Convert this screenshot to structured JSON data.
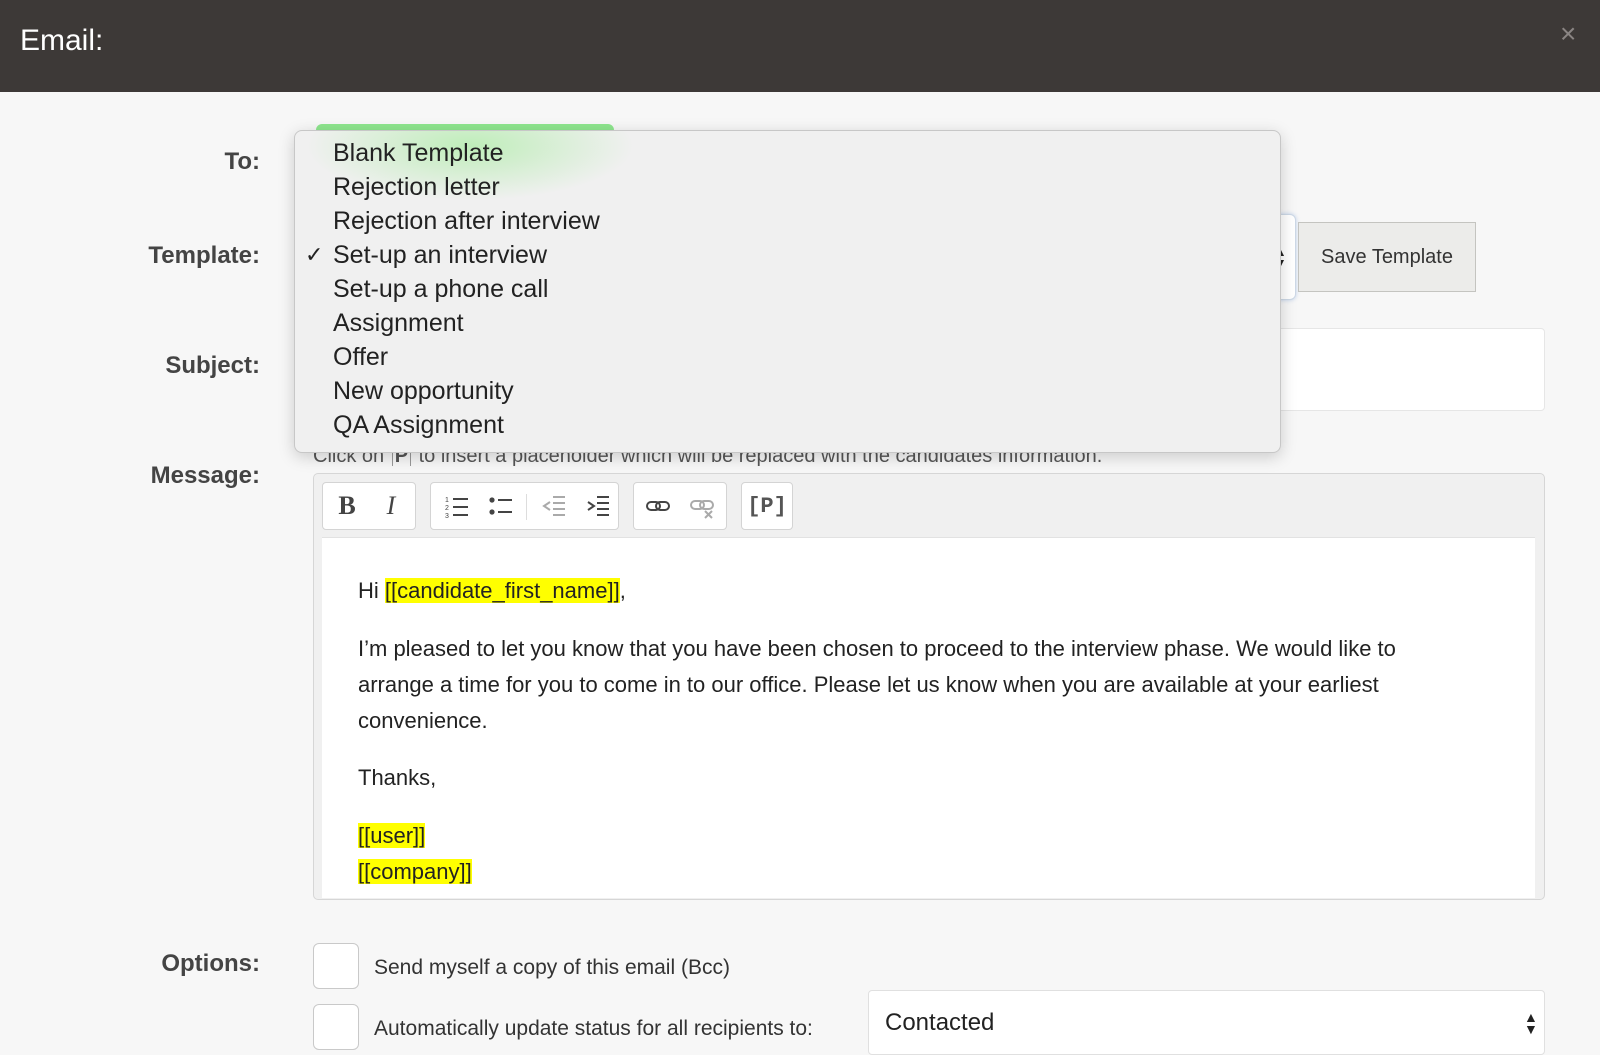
{
  "header": {
    "title": "Email:",
    "close_icon": "×"
  },
  "labels": {
    "to": "To:",
    "template": "Template:",
    "subject": "Subject:",
    "message": "Message:",
    "options": "Options:"
  },
  "template_dropdown": {
    "selected": "Set-up an interview",
    "check_glyph": "✓",
    "options": [
      "Blank Template",
      "Rejection letter",
      "Rejection after interview",
      "Set-up an interview",
      "Set-up a phone call",
      "Assignment",
      "Offer",
      "New opportunity",
      "QA Assignment"
    ]
  },
  "save_template_label": "Save Template",
  "hint": {
    "prefix": "Click on",
    "placeholder_glyph": "P",
    "suffix": "to insert a placeholder which will be replaced with the candidates information."
  },
  "toolbar": {
    "icons": [
      "bold-icon",
      "italic-icon",
      "ordered-list-icon",
      "bullet-list-icon",
      "outdent-icon",
      "indent-icon",
      "link-icon",
      "unlink-icon",
      "placeholder-icon"
    ],
    "bold_glyph": "B",
    "italic_glyph": "I",
    "placeholder_glyph": "[P]"
  },
  "message": {
    "greeting": "Hi ",
    "candidate_placeholder": "[[candidate_first_name]]",
    "greeting_end": ",",
    "body": "I’m pleased to let you know that you have been chosen to proceed to the interview phase. We would like to arrange a time for you to come in to our office. Please let us know when you are available at your earliest convenience.",
    "closing": "Thanks,",
    "user_placeholder": "[[user]]",
    "company_placeholder": "[[company]]"
  },
  "options": {
    "bcc_label": "Send myself a copy of this email (Bcc)",
    "bcc_checked": false,
    "status_label": "Automatically update status for all recipients to:",
    "status_checked": false,
    "status_value": "Contacted"
  },
  "colors": {
    "header_bg": "#3d3937",
    "placeholder_highlight": "#ffff00",
    "recipient_chip": "#8ee68e"
  }
}
